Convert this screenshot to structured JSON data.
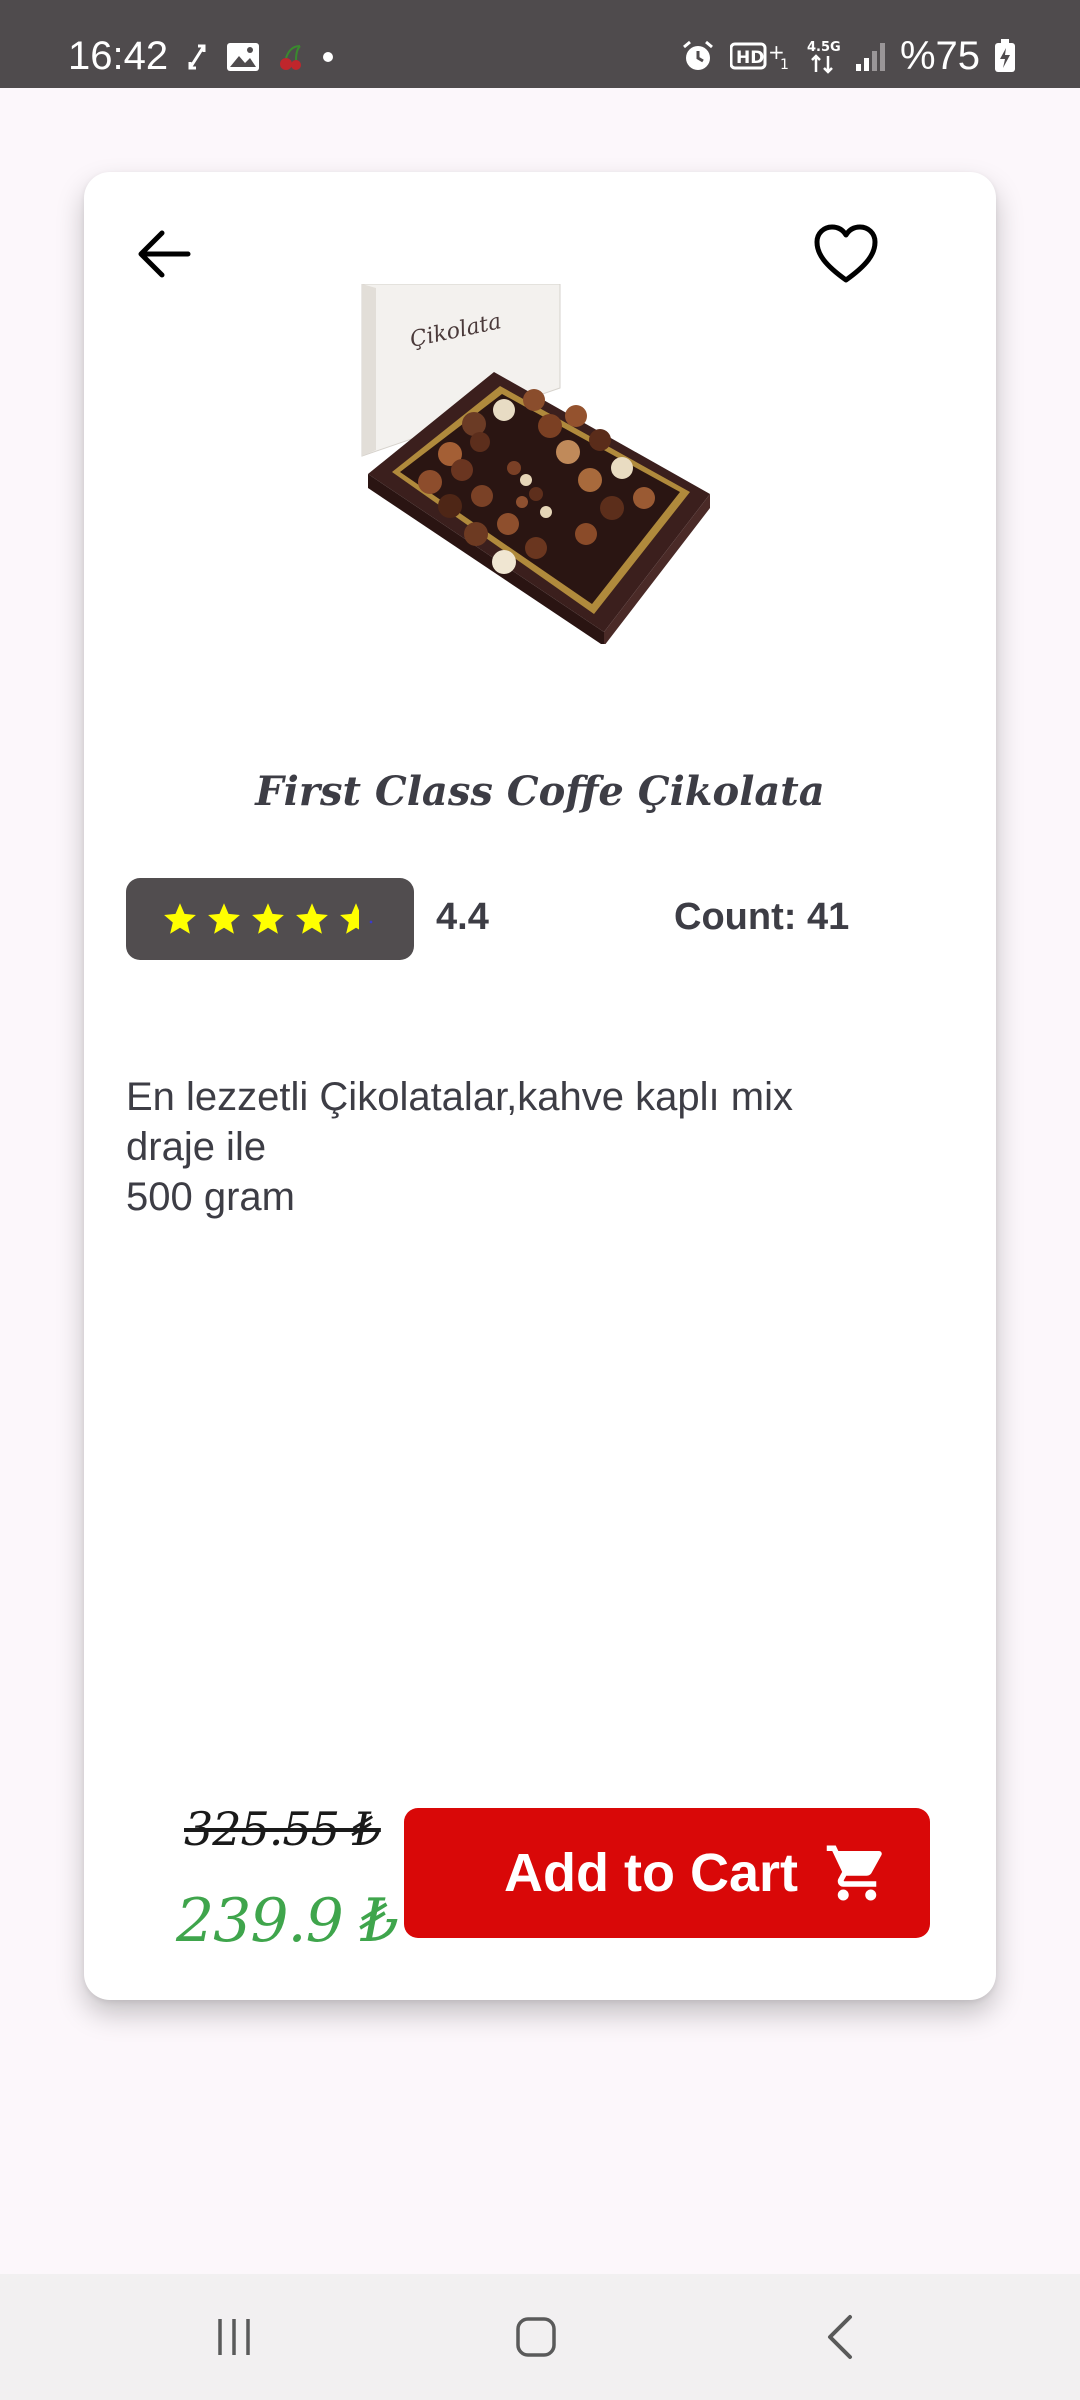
{
  "status_bar": {
    "time": "16:42",
    "battery": "%75"
  },
  "product": {
    "title": "First Class Coffe Çikolata",
    "rating": "4.4",
    "rating_stars_value": 4.4,
    "count_label": "Count: 41",
    "description": "En lezzetli Çikolatalar,kahve kaplı mix\ndraje ile\n500 gram",
    "old_price": "325.55 ₺",
    "new_price": "239.9 ₺",
    "box_lid_text": "Çikolata"
  },
  "actions": {
    "add_to_cart_label": "Add to Cart"
  },
  "colors": {
    "accent_red": "#d90808",
    "price_green": "#3fa54c",
    "rating_bg": "#514d4f",
    "star_yellow": "#ffff00"
  },
  "icons": {
    "back": "arrow-left-icon",
    "favorite": "heart-outline-icon",
    "cart": "shopping-cart-icon"
  }
}
